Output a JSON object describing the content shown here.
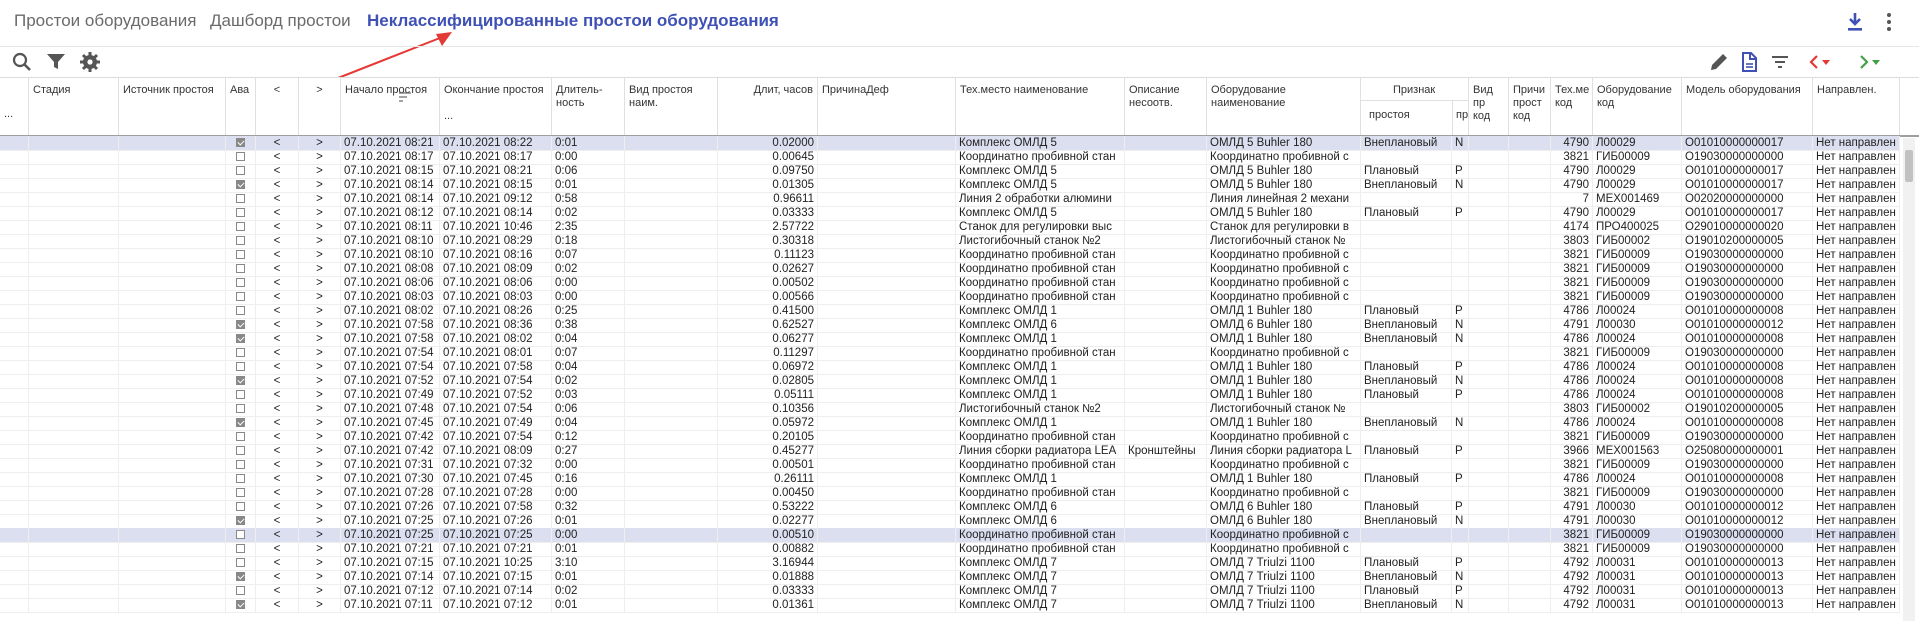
{
  "tabs": [
    "Простои оборудования",
    "Дашборд простои",
    "Неклассифицированные простои оборудования"
  ],
  "columns": {
    "dots": "...",
    "stage": "Стадия",
    "source": "Источник простоя",
    "ava": "Ава",
    "prev": "<",
    "next": ">",
    "start": "Начало простоя",
    "end": "Окончание простоя",
    "end_extra": "...",
    "dur": "Длитель-ность",
    "type": "Вид простоя наим.",
    "hours": "Длит, часов",
    "reason": "ПричинаДеф",
    "place": "Тех.место наименование",
    "desc": "Описание несоотв.",
    "equip": "Оборудование наименование",
    "sign": "Признак",
    "sign_sub1": "простоя",
    "sign_sub2": "пр",
    "type_code": "Вид пр код",
    "reason_code": "Причи прост код",
    "tech_code": "Тех.ме код",
    "equip_code": "Оборудование код",
    "model": "Модель оборудования",
    "direction": "Направлен."
  },
  "rows": [
    {
      "sel": true,
      "cb": true,
      "start": "07.10.2021 08:21",
      "end": "07.10.2021 08:22",
      "dur": "0:01",
      "hours": "0.02000",
      "place": "Комплекс ОМЛД 5",
      "desc": "",
      "equip": "ОМЛД 5 Buhler 180",
      "sign": "Внеплановый",
      "p": "N",
      "tc": "4790",
      "ec": "Л00029",
      "model": "О01010000000017",
      "dir": "Нет направлен"
    },
    {
      "sel": false,
      "cb": false,
      "start": "07.10.2021 08:17",
      "end": "07.10.2021 08:17",
      "dur": "0:00",
      "hours": "0.00645",
      "place": "Координатно пробивной стан",
      "desc": "",
      "equip": "Координатно пробивной с",
      "sign": "",
      "p": "",
      "tc": "3821",
      "ec": "ГИБ00009",
      "model": "О19030000000000",
      "dir": "Нет направлен"
    },
    {
      "sel": false,
      "cb": false,
      "start": "07.10.2021 08:15",
      "end": "07.10.2021 08:21",
      "dur": "0:06",
      "hours": "0.09750",
      "place": "Комплекс ОМЛД 5",
      "desc": "",
      "equip": "ОМЛД 5 Buhler 180",
      "sign": "Плановый",
      "p": "Р",
      "tc": "4790",
      "ec": "Л00029",
      "model": "О01010000000017",
      "dir": "Нет направлен"
    },
    {
      "sel": false,
      "cb": true,
      "start": "07.10.2021 08:14",
      "end": "07.10.2021 08:15",
      "dur": "0:01",
      "hours": "0.01305",
      "place": "Комплекс ОМЛД 5",
      "desc": "",
      "equip": "ОМЛД 5 Buhler 180",
      "sign": "Внеплановый",
      "p": "N",
      "tc": "4790",
      "ec": "Л00029",
      "model": "О01010000000017",
      "dir": "Нет направлен"
    },
    {
      "sel": false,
      "cb": false,
      "start": "07.10.2021 08:14",
      "end": "07.10.2021 09:12",
      "dur": "0:58",
      "hours": "0.96611",
      "place": "Линия 2 обработки алюмини",
      "desc": "",
      "equip": "Линия линейная 2 механи",
      "sign": "",
      "p": "",
      "tc": "7",
      "ec": "МЕХ001469",
      "model": "О02020000000000",
      "dir": "Нет направлен"
    },
    {
      "sel": false,
      "cb": false,
      "start": "07.10.2021 08:12",
      "end": "07.10.2021 08:14",
      "dur": "0:02",
      "hours": "0.03333",
      "place": "Комплекс ОМЛД 5",
      "desc": "",
      "equip": "ОМЛД 5 Buhler 180",
      "sign": "Плановый",
      "p": "Р",
      "tc": "4790",
      "ec": "Л00029",
      "model": "О01010000000017",
      "dir": "Нет направлен"
    },
    {
      "sel": false,
      "cb": false,
      "start": "07.10.2021 08:11",
      "end": "07.10.2021 10:46",
      "dur": "2:35",
      "hours": "2.57722",
      "place": "Станок для регулировки выс",
      "desc": "",
      "equip": "Станок для регулировки в",
      "sign": "",
      "p": "",
      "tc": "4174",
      "ec": "ПРО400025",
      "model": "О29010000000020",
      "dir": "Нет направлен"
    },
    {
      "sel": false,
      "cb": false,
      "start": "07.10.2021 08:10",
      "end": "07.10.2021 08:29",
      "dur": "0:18",
      "hours": "0.30318",
      "place": "Листогибочный станок №2",
      "desc": "",
      "equip": "Листогибочный станок №",
      "sign": "",
      "p": "",
      "tc": "3803",
      "ec": "ГИБ00002",
      "model": "О19010200000005",
      "dir": "Нет направлен"
    },
    {
      "sel": false,
      "cb": false,
      "start": "07.10.2021 08:10",
      "end": "07.10.2021 08:16",
      "dur": "0:07",
      "hours": "0.11123",
      "place": "Координатно пробивной стан",
      "desc": "",
      "equip": "Координатно пробивной с",
      "sign": "",
      "p": "",
      "tc": "3821",
      "ec": "ГИБ00009",
      "model": "О19030000000000",
      "dir": "Нет направлен"
    },
    {
      "sel": false,
      "cb": false,
      "start": "07.10.2021 08:08",
      "end": "07.10.2021 08:09",
      "dur": "0:02",
      "hours": "0.02627",
      "place": "Координатно пробивной стан",
      "desc": "",
      "equip": "Координатно пробивной с",
      "sign": "",
      "p": "",
      "tc": "3821",
      "ec": "ГИБ00009",
      "model": "О19030000000000",
      "dir": "Нет направлен"
    },
    {
      "sel": false,
      "cb": false,
      "start": "07.10.2021 08:06",
      "end": "07.10.2021 08:06",
      "dur": "0:00",
      "hours": "0.00502",
      "place": "Координатно пробивной стан",
      "desc": "",
      "equip": "Координатно пробивной с",
      "sign": "",
      "p": "",
      "tc": "3821",
      "ec": "ГИБ00009",
      "model": "О19030000000000",
      "dir": "Нет направлен"
    },
    {
      "sel": false,
      "cb": false,
      "start": "07.10.2021 08:03",
      "end": "07.10.2021 08:03",
      "dur": "0:00",
      "hours": "0.00566",
      "place": "Координатно пробивной стан",
      "desc": "",
      "equip": "Координатно пробивной с",
      "sign": "",
      "p": "",
      "tc": "3821",
      "ec": "ГИБ00009",
      "model": "О19030000000000",
      "dir": "Нет направлен"
    },
    {
      "sel": false,
      "cb": false,
      "start": "07.10.2021 08:02",
      "end": "07.10.2021 08:26",
      "dur": "0:25",
      "hours": "0.41500",
      "place": "Комплекс ОМЛД 1",
      "desc": "",
      "equip": "ОМЛД 1 Buhler 180",
      "sign": "Плановый",
      "p": "Р",
      "tc": "4786",
      "ec": "Л00024",
      "model": "О01010000000008",
      "dir": "Нет направлен"
    },
    {
      "sel": false,
      "cb": true,
      "start": "07.10.2021 07:58",
      "end": "07.10.2021 08:36",
      "dur": "0:38",
      "hours": "0.62527",
      "place": "Комплекс ОМЛД 6",
      "desc": "",
      "equip": "ОМЛД 6 Buhler 180",
      "sign": "Внеплановый",
      "p": "N",
      "tc": "4791",
      "ec": "Л00030",
      "model": "О01010000000012",
      "dir": "Нет направлен"
    },
    {
      "sel": false,
      "cb": true,
      "start": "07.10.2021 07:58",
      "end": "07.10.2021 08:02",
      "dur": "0:04",
      "hours": "0.06277",
      "place": "Комплекс ОМЛД 1",
      "desc": "",
      "equip": "ОМЛД 1 Buhler 180",
      "sign": "Внеплановый",
      "p": "N",
      "tc": "4786",
      "ec": "Л00024",
      "model": "О01010000000008",
      "dir": "Нет направлен"
    },
    {
      "sel": false,
      "cb": false,
      "start": "07.10.2021 07:54",
      "end": "07.10.2021 08:01",
      "dur": "0:07",
      "hours": "0.11297",
      "place": "Координатно пробивной стан",
      "desc": "",
      "equip": "Координатно пробивной с",
      "sign": "",
      "p": "",
      "tc": "3821",
      "ec": "ГИБ00009",
      "model": "О19030000000000",
      "dir": "Нет направлен"
    },
    {
      "sel": false,
      "cb": false,
      "start": "07.10.2021 07:54",
      "end": "07.10.2021 07:58",
      "dur": "0:04",
      "hours": "0.06972",
      "place": "Комплекс ОМЛД 1",
      "desc": "",
      "equip": "ОМЛД 1 Buhler 180",
      "sign": "Плановый",
      "p": "Р",
      "tc": "4786",
      "ec": "Л00024",
      "model": "О01010000000008",
      "dir": "Нет направлен"
    },
    {
      "sel": false,
      "cb": true,
      "start": "07.10.2021 07:52",
      "end": "07.10.2021 07:54",
      "dur": "0:02",
      "hours": "0.02805",
      "place": "Комплекс ОМЛД 1",
      "desc": "",
      "equip": "ОМЛД 1 Buhler 180",
      "sign": "Внеплановый",
      "p": "N",
      "tc": "4786",
      "ec": "Л00024",
      "model": "О01010000000008",
      "dir": "Нет направлен"
    },
    {
      "sel": false,
      "cb": false,
      "start": "07.10.2021 07:49",
      "end": "07.10.2021 07:52",
      "dur": "0:03",
      "hours": "0.05111",
      "place": "Комплекс ОМЛД 1",
      "desc": "",
      "equip": "ОМЛД 1 Buhler 180",
      "sign": "Плановый",
      "p": "Р",
      "tc": "4786",
      "ec": "Л00024",
      "model": "О01010000000008",
      "dir": "Нет направлен"
    },
    {
      "sel": false,
      "cb": false,
      "start": "07.10.2021 07:48",
      "end": "07.10.2021 07:54",
      "dur": "0:06",
      "hours": "0.10356",
      "place": "Листогибочный станок №2",
      "desc": "",
      "equip": "Листогибочный станок №",
      "sign": "",
      "p": "",
      "tc": "3803",
      "ec": "ГИБ00002",
      "model": "О19010200000005",
      "dir": "Нет направлен"
    },
    {
      "sel": false,
      "cb": true,
      "start": "07.10.2021 07:45",
      "end": "07.10.2021 07:49",
      "dur": "0:04",
      "hours": "0.05972",
      "place": "Комплекс ОМЛД 1",
      "desc": "",
      "equip": "ОМЛД 1 Buhler 180",
      "sign": "Внеплановый",
      "p": "N",
      "tc": "4786",
      "ec": "Л00024",
      "model": "О01010000000008",
      "dir": "Нет направлен"
    },
    {
      "sel": false,
      "cb": false,
      "start": "07.10.2021 07:42",
      "end": "07.10.2021 07:54",
      "dur": "0:12",
      "hours": "0.20105",
      "place": "Координатно пробивной стан",
      "desc": "",
      "equip": "Координатно пробивной с",
      "sign": "",
      "p": "",
      "tc": "3821",
      "ec": "ГИБ00009",
      "model": "О19030000000000",
      "dir": "Нет направлен"
    },
    {
      "sel": false,
      "cb": false,
      "start": "07.10.2021 07:42",
      "end": "07.10.2021 08:09",
      "dur": "0:27",
      "hours": "0.45277",
      "place": "Линия сборки радиатора LEA",
      "desc": "Кронштейны",
      "equip": "Линия сборки радиатора L",
      "sign": "Плановый",
      "p": "Р",
      "tc": "3966",
      "ec": "МЕХ001563",
      "model": "О25080000000001",
      "dir": "Нет направлен"
    },
    {
      "sel": false,
      "cb": false,
      "start": "07.10.2021 07:31",
      "end": "07.10.2021 07:32",
      "dur": "0:00",
      "hours": "0.00501",
      "place": "Координатно пробивной стан",
      "desc": "",
      "equip": "Координатно пробивной с",
      "sign": "",
      "p": "",
      "tc": "3821",
      "ec": "ГИБ00009",
      "model": "О19030000000000",
      "dir": "Нет направлен"
    },
    {
      "sel": false,
      "cb": false,
      "start": "07.10.2021 07:30",
      "end": "07.10.2021 07:45",
      "dur": "0:16",
      "hours": "0.26111",
      "place": "Комплекс ОМЛД 1",
      "desc": "",
      "equip": "ОМЛД 1 Buhler 180",
      "sign": "Плановый",
      "p": "Р",
      "tc": "4786",
      "ec": "Л00024",
      "model": "О01010000000008",
      "dir": "Нет направлен"
    },
    {
      "sel": false,
      "cb": false,
      "start": "07.10.2021 07:28",
      "end": "07.10.2021 07:28",
      "dur": "0:00",
      "hours": "0.00450",
      "place": "Координатно пробивной стан",
      "desc": "",
      "equip": "Координатно пробивной с",
      "sign": "",
      "p": "",
      "tc": "3821",
      "ec": "ГИБ00009",
      "model": "О19030000000000",
      "dir": "Нет направлен"
    },
    {
      "sel": false,
      "cb": false,
      "start": "07.10.2021 07:26",
      "end": "07.10.2021 07:58",
      "dur": "0:32",
      "hours": "0.53222",
      "place": "Комплекс ОМЛД 6",
      "desc": "",
      "equip": "ОМЛД 6 Buhler 180",
      "sign": "Плановый",
      "p": "Р",
      "tc": "4791",
      "ec": "Л00030",
      "model": "О01010000000012",
      "dir": "Нет направлен"
    },
    {
      "sel": false,
      "cb": true,
      "start": "07.10.2021 07:25",
      "end": "07.10.2021 07:26",
      "dur": "0:01",
      "hours": "0.02277",
      "place": "Комплекс ОМЛД 6",
      "desc": "",
      "equip": "ОМЛД 6 Buhler 180",
      "sign": "Внеплановый",
      "p": "N",
      "tc": "4791",
      "ec": "Л00030",
      "model": "О01010000000012",
      "dir": "Нет направлен"
    },
    {
      "sel": true,
      "cb": false,
      "start": "07.10.2021 07:25",
      "end": "07.10.2021 07:25",
      "dur": "0:00",
      "hours": "0.00510",
      "place": "Координатно пробивной стан",
      "desc": "",
      "equip": "Координатно пробивной с",
      "sign": "",
      "p": "",
      "tc": "3821",
      "ec": "ГИБ00009",
      "model": "О19030000000000",
      "dir": "Нет направлен"
    },
    {
      "sel": false,
      "cb": false,
      "start": "07.10.2021 07:21",
      "end": "07.10.2021 07:21",
      "dur": "0:01",
      "hours": "0.00882",
      "place": "Координатно пробивной стан",
      "desc": "",
      "equip": "Координатно пробивной с",
      "sign": "",
      "p": "",
      "tc": "3821",
      "ec": "ГИБ00009",
      "model": "О19030000000000",
      "dir": "Нет направлен"
    },
    {
      "sel": false,
      "cb": false,
      "start": "07.10.2021 07:15",
      "end": "07.10.2021 10:25",
      "dur": "3:10",
      "hours": "3.16944",
      "place": "Комплекс ОМЛД 7",
      "desc": "",
      "equip": "ОМЛД 7 Triulzi 1100",
      "sign": "Плановый",
      "p": "Р",
      "tc": "4792",
      "ec": "Л00031",
      "model": "О01010000000013",
      "dir": "Нет направлен"
    },
    {
      "sel": false,
      "cb": true,
      "start": "07.10.2021 07:14",
      "end": "07.10.2021 07:15",
      "dur": "0:01",
      "hours": "0.01888",
      "place": "Комплекс ОМЛД 7",
      "desc": "",
      "equip": "ОМЛД 7 Triulzi 1100",
      "sign": "Внеплановый",
      "p": "N",
      "tc": "4792",
      "ec": "Л00031",
      "model": "О01010000000013",
      "dir": "Нет направлен"
    },
    {
      "sel": false,
      "cb": false,
      "start": "07.10.2021 07:12",
      "end": "07.10.2021 07:14",
      "dur": "0:02",
      "hours": "0.03333",
      "place": "Комплекс ОМЛД 7",
      "desc": "",
      "equip": "ОМЛД 7 Triulzi 1100",
      "sign": "Плановый",
      "p": "Р",
      "tc": "4792",
      "ec": "Л00031",
      "model": "О01010000000013",
      "dir": "Нет направлен"
    },
    {
      "sel": false,
      "cb": true,
      "start": "07.10.2021 07:11",
      "end": "07.10.2021 07:12",
      "dur": "0:01",
      "hours": "0.01361",
      "place": "Комплекс ОМЛД 7",
      "desc": "",
      "equip": "ОМЛД 7 Triulzi 1100",
      "sign": "Внеплановый",
      "p": "N",
      "tc": "4792",
      "ec": "Л00031",
      "model": "О01010000000013",
      "dir": "Нет направлен"
    }
  ]
}
